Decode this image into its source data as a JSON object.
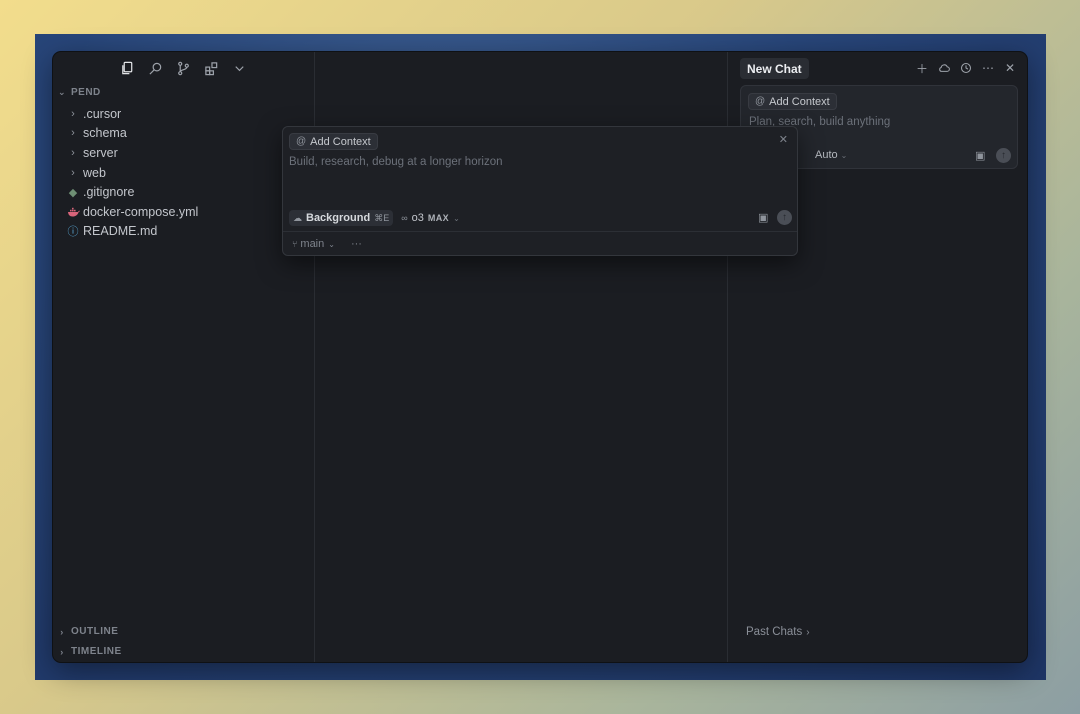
{
  "sidebar": {
    "toolbar": [
      {
        "name": "explorer-icon",
        "glyph": "copy"
      },
      {
        "name": "search-icon",
        "glyph": "search"
      },
      {
        "name": "source-control-icon",
        "glyph": "branch"
      },
      {
        "name": "extensions-icon",
        "glyph": "grid"
      },
      {
        "name": "chevron-down-icon",
        "glyph": "chevron"
      }
    ],
    "project_title": "PEND",
    "items": [
      {
        "label": ".cursor",
        "icon": "chevron-right"
      },
      {
        "label": "schema",
        "icon": "chevron-right"
      },
      {
        "label": "server",
        "icon": "chevron-right"
      },
      {
        "label": "web",
        "icon": "chevron-right"
      },
      {
        "label": ".gitignore",
        "icon": "git"
      },
      {
        "label": "docker-compose.yml",
        "icon": "docker"
      },
      {
        "label": "README.md",
        "icon": "info"
      }
    ],
    "outline_label": "OUTLINE",
    "timeline_label": "TIMELINE"
  },
  "chat": {
    "tab_label": "New Chat",
    "add_context": "Add Context",
    "placeholder": "Plan, search, build anything",
    "mode": "Auto",
    "past_chats": "Past Chats"
  },
  "agent_popup": {
    "add_context": "Add Context",
    "placeholder": "Build, research, debug at a longer horizon",
    "background_label": "Background",
    "background_shortcut": "⌘E",
    "model": "o3",
    "model_badge": "MAX",
    "branch": "main",
    "more": "···"
  }
}
